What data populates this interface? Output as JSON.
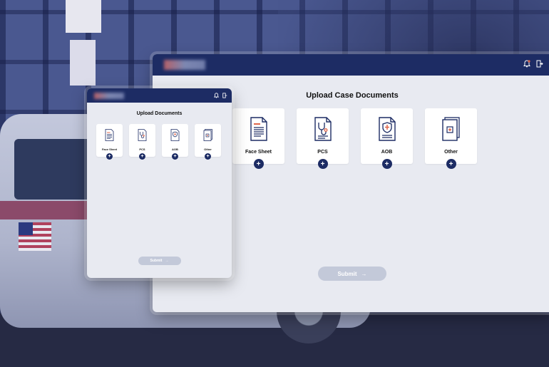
{
  "large_window": {
    "title": "Upload Case Documents",
    "documents": [
      {
        "label": "Face Sheet",
        "icon": "face-sheet-document-icon"
      },
      {
        "label": "PCS",
        "icon": "pcs-stethoscope-document-icon"
      },
      {
        "label": "AOB",
        "icon": "aob-shield-document-icon"
      },
      {
        "label": "Other",
        "icon": "other-stacked-document-icon"
      }
    ],
    "submit_label": "Submit",
    "submit_arrow": "→"
  },
  "small_window": {
    "title": "Upload Documents",
    "documents": [
      {
        "label": "Face Sheet",
        "icon": "face-sheet-document-icon"
      },
      {
        "label": "PCS",
        "icon": "pcs-stethoscope-document-icon"
      },
      {
        "label": "AOB",
        "icon": "aob-shield-document-icon"
      },
      {
        "label": "Other",
        "icon": "other-stacked-document-icon"
      }
    ],
    "submit_label": "Submit",
    "submit_arrow": "→"
  },
  "add_glyph": "+",
  "colors": {
    "header": "#1d2c64",
    "panel": "#e8eaf1",
    "submit_disabled": "#c3c9d9",
    "icon_accent": "#e0664a"
  }
}
